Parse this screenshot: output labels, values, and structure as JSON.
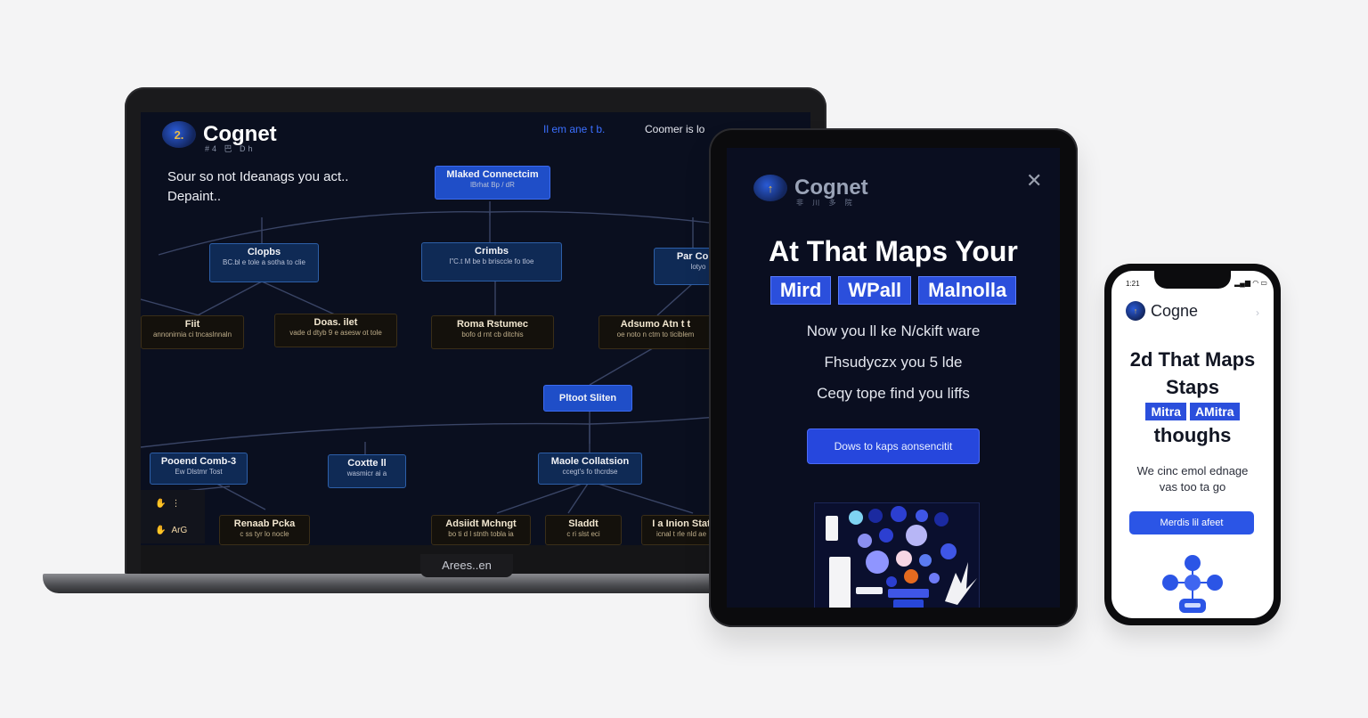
{
  "laptop": {
    "brand": "Cognet",
    "brand_sub": "#4 巴 Dh",
    "nav": [
      "Il em ane t b.",
      "Coomer is lo"
    ],
    "tagline": [
      "Sour so not Ideanags you act..",
      "Depaint.."
    ],
    "bottom_tab": "Arees..en",
    "nodes": [
      {
        "title": "Mlaked Connectcim",
        "sub": "lBrhat Bp / dR"
      },
      {
        "title": "Clopbs",
        "sub": "BC.bl e tole a sotha to clie"
      },
      {
        "title": "Crimbs",
        "sub": "l\"C.t M be b brisccle fo tloe"
      },
      {
        "title": "Par Copy",
        "sub": "lotyo"
      },
      {
        "title": "Fiit",
        "sub": "annonirnia ci tncaslnnaln"
      },
      {
        "title": "Doas. ilet",
        "sub": "vade d dtyb 9 e asesw ot tole"
      },
      {
        "title": "Roma Rstumec",
        "sub": "bofo d rnt cb ditchis"
      },
      {
        "title": "Adsumo Atn t t",
        "sub": "oe noto n ctm to ticiblem"
      },
      {
        "title": "Pltoot Sliten",
        "sub": ""
      },
      {
        "title": "Pooend Comb-3",
        "sub": "Ew Dlstmr Tost"
      },
      {
        "title": "Coxtte ll",
        "sub": "wasmicr ai a"
      },
      {
        "title": "Maole Collatsion",
        "sub": "ccegt's fo thcrdse"
      },
      {
        "title": "Renaab Pcka",
        "sub": "c ss tyr lo nocle"
      },
      {
        "title": "Adsiidt Mchngt",
        "sub": "bo ti d l stnth tobla ia"
      },
      {
        "title": "Sladdt",
        "sub": "c ri slst eci"
      },
      {
        "title": "I a Inion Stat",
        "sub": "icnal t rle nld ae"
      }
    ],
    "tools": [
      {
        "icon": "hand-icon",
        "label": "⋮"
      },
      {
        "icon": "hand-icon",
        "label": "ArG"
      }
    ]
  },
  "tablet": {
    "brand": "Cognet",
    "brand_sub": "非 川 多 院",
    "headline": "At That Maps Your",
    "pills": [
      "Mird",
      "WPall",
      "Malnolla"
    ],
    "lines": [
      "Now you ll ke N/ckift ware",
      "Fhsudyczx you 5 lde",
      "Ceqy tope find you liffs"
    ],
    "cta": "Dows to kaps aonsencitit",
    "close": "✕"
  },
  "phone": {
    "time": "1:21",
    "brand": "Cogne",
    "headline": [
      "2d That Maps",
      "Staps"
    ],
    "pills": [
      "Mitra",
      "AMitra"
    ],
    "headline2": "thoughs",
    "body": [
      "We cinc emol ednage",
      "vas too ta go"
    ],
    "cta": "Merdis lil afeet"
  },
  "colors": {
    "accent": "#2b4fdc",
    "dark_bg": "#0a0f1f",
    "node_blue": "#1f4ec8",
    "node_navy": "#0f2a55"
  }
}
